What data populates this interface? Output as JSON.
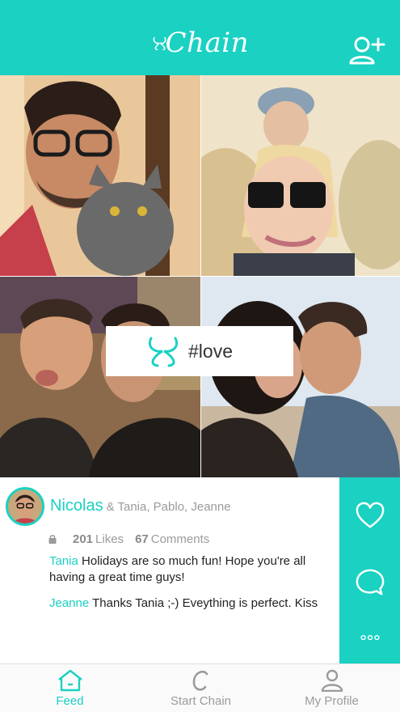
{
  "header": {
    "logo_text": "Chain",
    "logo_icon": "chain-logo-icon",
    "add_friend_icon": "add-user-icon"
  },
  "chain": {
    "hashtag": "#love",
    "photos": [
      {
        "name": "photo-man-with-cat"
      },
      {
        "name": "photo-child-on-shoulders"
      },
      {
        "name": "photo-two-men"
      },
      {
        "name": "photo-couple-kissing"
      }
    ]
  },
  "post": {
    "author": "Nicolas",
    "coauthors": "& Tania, Pablo, Jeanne",
    "likes_count": "201",
    "likes_label": "Likes",
    "comments_count": "67",
    "comments_label": "Comments",
    "comments": [
      {
        "user": "Tania",
        "text": "Holidays are so much fun! Hope you're all having a great time guys!"
      },
      {
        "user": "Jeanne",
        "text": "Thanks Tania ;-) Eveything is perfect. Kiss"
      }
    ]
  },
  "actions": {
    "like_icon": "heart-icon",
    "comment_icon": "comment-bubble-icon",
    "more_icon": "more-dots-icon"
  },
  "tabs": [
    {
      "label": "Feed",
      "icon": "home-icon",
      "active": true
    },
    {
      "label": "Start Chain",
      "icon": "chain-c-icon",
      "active": false
    },
    {
      "label": "My Profile",
      "icon": "profile-icon",
      "active": false
    }
  ],
  "colors": {
    "brand": "#1ad1c2",
    "text": "#222222",
    "muted": "#9b9b9b"
  }
}
